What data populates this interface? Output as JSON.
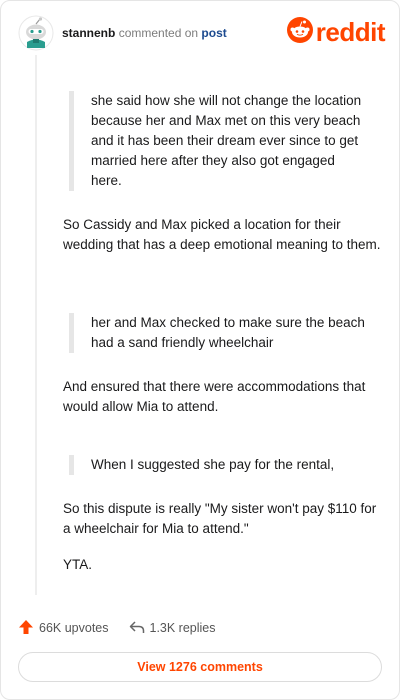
{
  "post": {
    "username": "stannenb",
    "action_text": "commented on",
    "link_text": "post"
  },
  "brand": {
    "logo_text": "reddit",
    "color": "#ff4500"
  },
  "content": {
    "quote1": "she said how she will not change the location because her and Max met on this very beach and it has been their dream ever since to get married here after they also got engaged here.",
    "para1": "So Cassidy and Max picked a location for their wedding that has a deep emotional meaning to them.",
    "quote2": "her and Max checked to make sure the beach had a sand friendly wheelchair",
    "para2": "And ensured that there were accommodations that would allow Mia to attend.",
    "quote3": "When I suggested she pay for the rental,",
    "para3": "So this dispute is really \"My sister won't pay $110 for a wheelchair for Mia to attend.\"",
    "para4": "YTA."
  },
  "footer": {
    "upvotes": "66K upvotes",
    "replies": "1.3K replies",
    "view_comments": "View 1276 comments"
  },
  "icons": {
    "avatar": "snoo-avatar-icon",
    "logo": "reddit-alien-icon",
    "upvote": "upvote-arrow-icon",
    "reply": "reply-arrow-icon"
  }
}
